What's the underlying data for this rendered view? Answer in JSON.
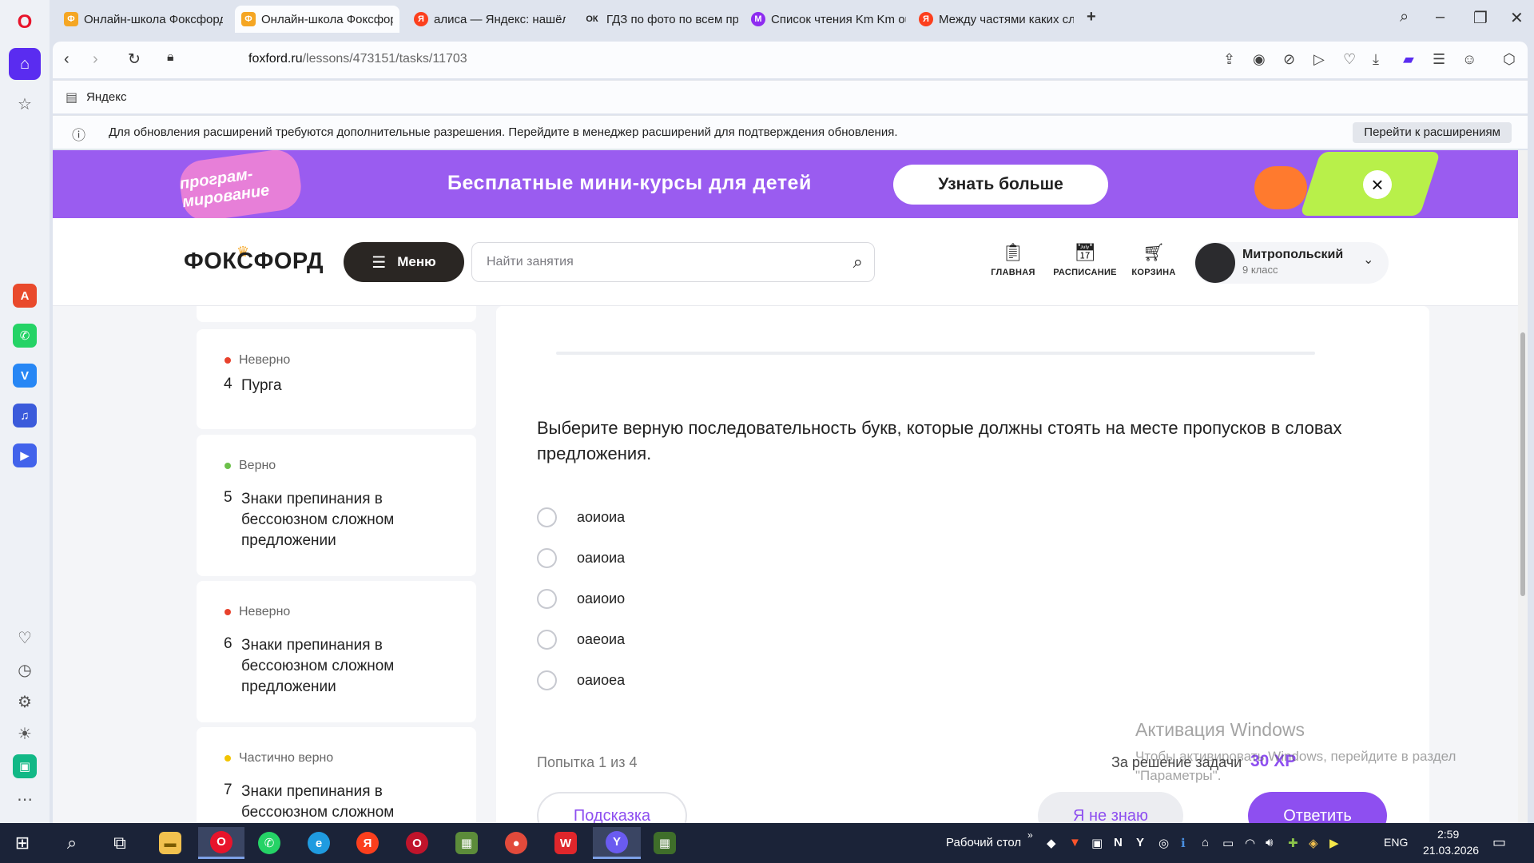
{
  "browser": {
    "tabs": [
      {
        "title": "Онлайн-школа Фоксфорд",
        "fav_color": "#f5a623",
        "fav_glyph": "Ф"
      },
      {
        "title": "Онлайн-школа Фоксфорд",
        "fav_color": "#f5a623",
        "fav_glyph": "Ф"
      },
      {
        "title": "алиса — Яндекс: нашёлся",
        "fav_color": "#fc3f1d",
        "fav_glyph": "Я"
      },
      {
        "title": "ГДЗ по фото по всем пре",
        "fav_color": "#222222",
        "fav_glyph": "ОК"
      },
      {
        "title": "Список чтения Km Km ou",
        "fav_color": "#8e2cf0",
        "fav_glyph": "M"
      },
      {
        "title": "Между частями каких сло",
        "fav_color": "#fc3f1d",
        "fav_glyph": "Я"
      }
    ],
    "url_host": "foxford.ru",
    "url_path": "/lessons/473151/tasks/11703",
    "bookmark": "Яндекс",
    "info_text": "Для обновления расширений требуются дополнительные разрешения. Перейдите в менеджер расширений для подтверждения обновления.",
    "info_button": "Перейти к расширениям"
  },
  "promo": {
    "text": "Бесплатные мини-курсы для детей",
    "button": "Узнать больше",
    "art_text": "програм- мирование"
  },
  "header": {
    "logo": "ФОКСФОРД",
    "menu_label": "Меню",
    "search_placeholder": "Найти занятия",
    "nav": [
      {
        "label": "ГЛАВНАЯ",
        "icon": "clipboard-icon"
      },
      {
        "label": "РАСПИСАНИЕ",
        "icon": "calendar-icon"
      },
      {
        "label": "КОРЗИНА",
        "icon": "cart-icon"
      }
    ],
    "user_name": "Митропольский",
    "user_grade": "9 класс"
  },
  "sidebar": {
    "cards": [
      {
        "status": "Неверно",
        "status_color": "#e8412c",
        "num": "4",
        "title": "Пурга"
      },
      {
        "status": "Верно",
        "status_color": "#6cc04a",
        "num": "5",
        "title": "Знаки препинания в бессоюзном сложном предложении"
      },
      {
        "status": "Неверно",
        "status_color": "#e8412c",
        "num": "6",
        "title": "Знаки препинания в бессоюзном сложном предложении"
      },
      {
        "status": "Частично верно",
        "status_color": "#f2c400",
        "num": "7",
        "title": "Знаки препинания в бессоюзном сложном"
      }
    ]
  },
  "task": {
    "question": "Выберите верную последовательность букв, которые должны стоять на месте пропусков в словах предложения.",
    "options": [
      "аоиоиа",
      "оаиоиа",
      "оаиоио",
      "оаеоиа",
      "оаиоеа"
    ],
    "attempt": "Попытка 1 из 4",
    "reward_label": "За решение задачи",
    "reward_xp": "30 XP",
    "hint_button": "Подсказка",
    "dunno_button": "Я не знаю",
    "answer_button": "Ответить"
  },
  "watermark": {
    "title": "Активация Windows",
    "text": "Чтобы активировать Windows, перейдите в раздел \"Параметры\"."
  },
  "taskbar": {
    "desktop_label": "Рабочий стол",
    "lang": "ENG",
    "time": "2:59",
    "date": "21.03.2026"
  }
}
